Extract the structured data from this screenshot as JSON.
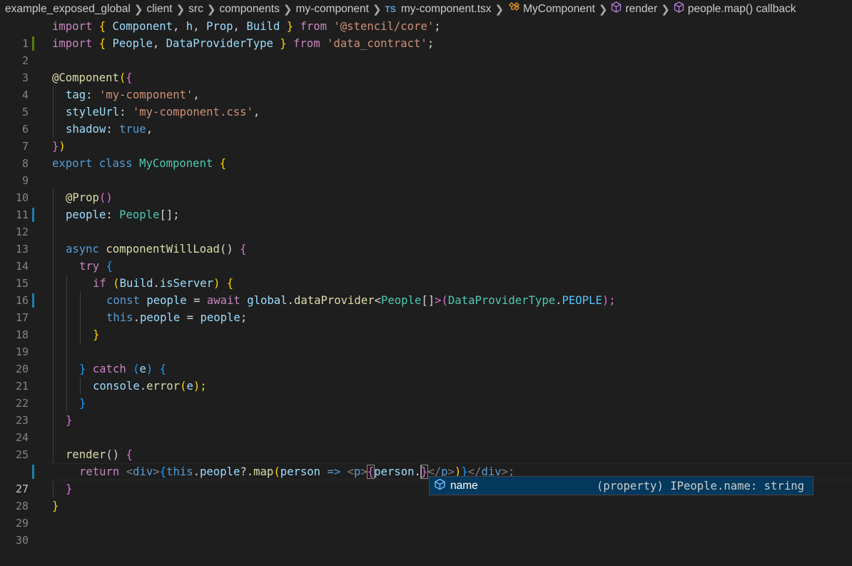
{
  "breadcrumb": {
    "items": [
      "example_exposed_global",
      "client",
      "src",
      "components",
      "my-component"
    ],
    "ts_badge": "TS",
    "file": "my-component.tsx",
    "symbols": [
      "MyComponent",
      "render",
      "people.map() callback"
    ]
  },
  "editor": {
    "line_numbers": [
      "1",
      "2",
      "3",
      "4",
      "5",
      "6",
      "7",
      "8",
      "9",
      "10",
      "11",
      "12",
      "13",
      "14",
      "15",
      "16",
      "17",
      "18",
      "19",
      "20",
      "21",
      "22",
      "23",
      "24",
      "25",
      "26",
      "27",
      "28",
      "29",
      "30"
    ],
    "current_line": 27,
    "code": {
      "l1": [
        "import",
        "{ ",
        "Component",
        ", ",
        "h",
        ", ",
        "Prop",
        ", ",
        "Build",
        " } ",
        "from",
        " ",
        "'@stencil/core'",
        ";"
      ],
      "l2": [
        "import",
        "{ ",
        "People",
        ", ",
        "DataProviderType",
        " } ",
        "from",
        " ",
        "'data_contract'",
        ";"
      ],
      "l4": [
        "@",
        "Component",
        "(",
        "{"
      ],
      "l5": [
        "tag",
        ": ",
        "'my-component'",
        ","
      ],
      "l6": [
        "styleUrl",
        ": ",
        "'my-component.css'",
        ","
      ],
      "l7": [
        "shadow",
        ": ",
        "true",
        ","
      ],
      "l8": [
        "}",
        ")"
      ],
      "l9": [
        "export",
        " ",
        "class",
        " ",
        "MyComponent",
        " ",
        "{"
      ],
      "l11": [
        "@",
        "Prop",
        "()"
      ],
      "l12": [
        "people",
        ": ",
        "People",
        "[]",
        ";"
      ],
      "l14": [
        "async",
        " ",
        "componentWillLoad",
        "() ",
        "{"
      ],
      "l15": [
        "try",
        " ",
        "{"
      ],
      "l16": [
        "if",
        " (",
        "Build",
        ".",
        "isServer",
        ") ",
        "{"
      ],
      "l17": [
        "const",
        " ",
        "people",
        " = ",
        "await",
        " ",
        "global",
        ".",
        "dataProvider",
        "<",
        "People",
        "[]",
        ">(",
        "DataProviderType",
        ".",
        "PEOPLE",
        ");"
      ],
      "l18": [
        "this",
        ".",
        "people",
        " = ",
        "people",
        ";"
      ],
      "l19": [
        "}"
      ],
      "l21": [
        "}",
        " ",
        "catch",
        " (",
        "e",
        ") ",
        "{"
      ],
      "l22": [
        "console",
        ".",
        "error",
        "(",
        "e",
        ");"
      ],
      "l23": [
        "}"
      ],
      "l24": [
        "}"
      ],
      "l26": [
        "render",
        "() ",
        "{"
      ],
      "l27": [
        "return",
        " ",
        "<",
        "div",
        ">",
        "{",
        "this",
        ".",
        "people",
        "?.",
        "map",
        "(",
        "person",
        " => ",
        "<",
        "p",
        ">",
        "{",
        "person",
        ".",
        "}",
        "</",
        "p",
        ">",
        ")",
        "}",
        "</",
        "div",
        ">;"
      ],
      "l28": [
        "}"
      ],
      "l29": [
        "}"
      ]
    }
  },
  "suggest": {
    "label": "name",
    "detail": "(property) IPeople.name: string",
    "icon": "property-cube-icon"
  },
  "colors": {
    "background": "#1e1e1e",
    "keyword": "#569cd6",
    "control": "#c586c0",
    "string": "#ce9178",
    "variable": "#9cdcfe",
    "function": "#dcdcaa",
    "type": "#4ec9b0",
    "suggest_selected": "#04395e"
  }
}
